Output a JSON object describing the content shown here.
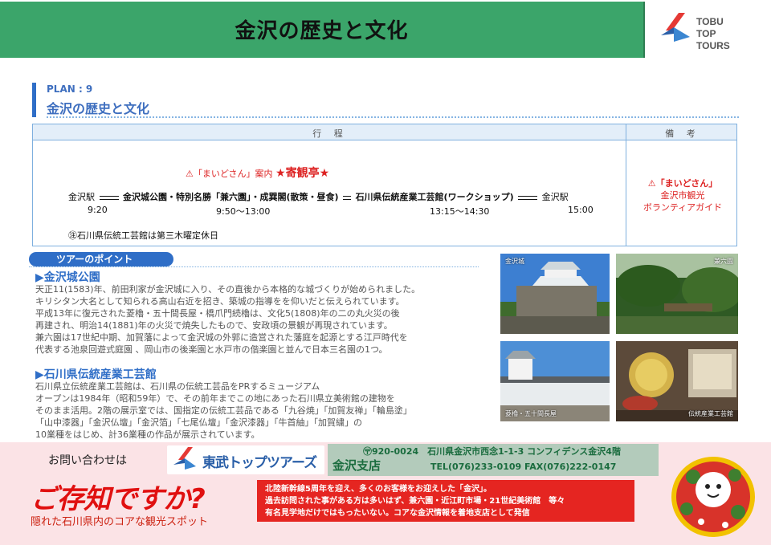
{
  "header": {
    "title": "金沢の歴史と文化"
  },
  "brand": {
    "line1": "TOBU",
    "line2": "TOP",
    "line3": "TOURS"
  },
  "plan": {
    "number": "PLAN : 9",
    "title": "金沢の歴史と文化"
  },
  "itinerary": {
    "head_left": "行 程",
    "head_right": "備 考",
    "guide_prefix": "⚠「まいどさん」案内",
    "guide_star": "★寄観亭★",
    "stop_start": "金沢駅",
    "stop_1": "金沢城公園・特別名勝「兼六園」・成巽閣(散策・昼食)",
    "stop_2": "石川県伝統産業工芸館(ワークショップ)",
    "stop_end": "金沢駅",
    "time_start": "9:20",
    "time_1": "9:50～13:00",
    "time_2": "13:15～14:30",
    "time_end": "15:00",
    "note": "㊟石川県伝統工芸館は第三木曜定休日",
    "remark_1": "⚠「まいどさん」",
    "remark_2": "金沢市観光",
    "remark_3": "ボランティアガイド"
  },
  "points": {
    "label": "ツアーのポイント",
    "section1_title": "▶金沢城公園",
    "section1_lines": [
      "天正11(1583)年、前田利家が金沢城に入り、その直後から本格的な城づくりが始められました。",
      "キリシタン大名として知られる高山右近を招き、築城の指導をを仰いだと伝えられています。",
      "平成13年に復元された菱櫓・五十間長屋・橋爪門続櫓は、文化5(1808)年の二の丸火災の後",
      "再建され、明治14(1881)年の火災で焼失したもので、安政頃の景観が再現されています。",
      "兼六園は17世紀中期、加賀藩によって金沢城の外郭に造営された藩庭を起源とする江戸時代を",
      "代表する池泉回遊式庭園 、岡山市の後楽園と水戸市の偕楽園と並んで日本三名園の1つ。"
    ],
    "section2_title": "▶石川県伝統産業工芸館",
    "section2_lines": [
      "石川県立伝統産業工芸館は、石川県の伝統工芸品をPRするミュージアム",
      "オープンは1984年（昭和59年）で、その前年までこの地にあった石川県立美術館の建物を",
      "そのまま活用。2階の展示室では、国指定の伝統工芸品である「九谷焼」「加賀友禅」「輪島塗」",
      "「山中漆器」「金沢仏壇」「金沢箔」「七尾仏壇」「金沢漆器」「牛首紬」「加賀繍」の",
      "10業種をはじめ、計36業種の作品が展示されています。"
    ]
  },
  "photos": {
    "p1": "金沢城",
    "p2": "兼六園",
    "p3": "菱櫓・五十間長屋",
    "p4": "伝統産業工芸館"
  },
  "contact": {
    "ask": "お問い合わせは",
    "company": "東武トップツアーズ",
    "address": "〶920-0024　石川県金沢市西念1-1-3 コンフィデンス金沢4階",
    "branch": "金沢支店",
    "tel": "TEL(076)233-0109  FAX(076)222-0147"
  },
  "footer": {
    "catch": "ご存知ですか?",
    "catch_sub": "隠れた石川県内のコアな観光スポット",
    "notice_lines": [
      "北陸新幹線5周年を迎え、多くのお客様をお迎えした「金沢」。",
      "過去訪問された事がある方は多いはず、兼六園・近江町市場・21世紀美術館　等々",
      "有名見学地だけではもったいない。コアな金沢情報を着地支店として発信"
    ]
  },
  "colors": {
    "header_green": "#3ba56a",
    "accent_blue": "#2f6ec7",
    "alert_red": "#e52521"
  }
}
